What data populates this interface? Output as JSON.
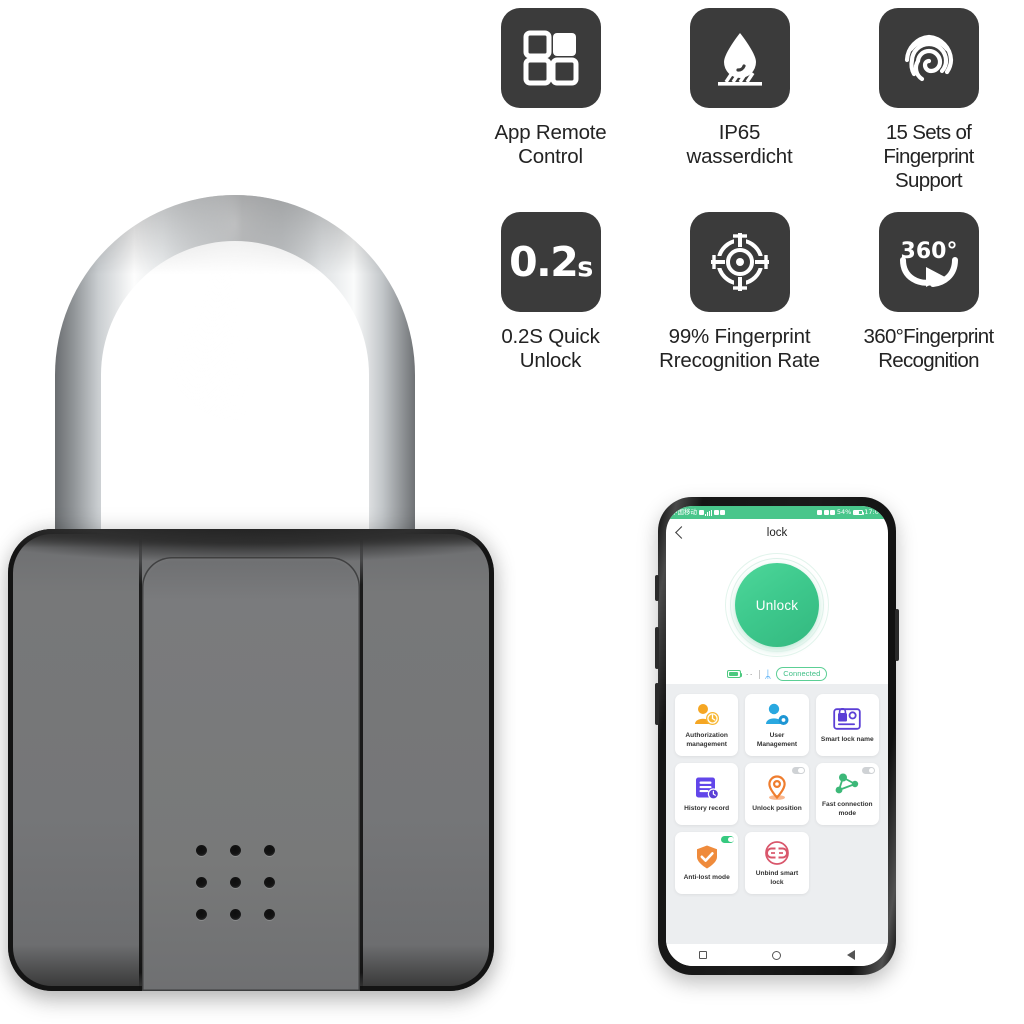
{
  "product": {
    "name": "Smart Fingerprint Padlock",
    "body_color": "#787878",
    "accent_dark": "#3b3b3b",
    "accent_green": "#3ec98d"
  },
  "features": [
    {
      "icon": "app-grid-icon",
      "label": "App Remote\nControl"
    },
    {
      "icon": "water-drop-icon",
      "label": "IP65\nwasserdicht"
    },
    {
      "icon": "fingerprint-icon",
      "label": "15 Sets of\nFingerprint\nSupport"
    },
    {
      "icon": "speed-text-icon",
      "label": "0.2S Quick\nUnlock",
      "tile_text": "0.2",
      "tile_unit": "s"
    },
    {
      "icon": "target-icon",
      "label": "99% Fingerprint\nRrecognition Rate"
    },
    {
      "icon": "rotate-360-icon",
      "label": "360°Fingerprint\nRecognition",
      "tile_text": "360°"
    }
  ],
  "phone": {
    "statusbar": {
      "carrier": "中国移动",
      "battery_percent": "54%",
      "time": "17:00"
    },
    "appbar": {
      "title": "lock",
      "back_icon": "back-chevron-icon"
    },
    "unlock_button": {
      "label": "Unlock"
    },
    "connection": {
      "battery_icon": "battery-icon",
      "signal_dots": "··",
      "bluetooth_icon": "bluetooth-icon",
      "bluetooth_glyph": "ᛦ",
      "status_label": "Connected"
    },
    "tiles": [
      {
        "icon": "authorization-icon",
        "label": "Authorization\nmanagement",
        "toggle": null
      },
      {
        "icon": "user-management-icon",
        "label": "User\nManagement",
        "toggle": null
      },
      {
        "icon": "smart-lock-name-icon",
        "label": "Smart lock name",
        "toggle": null
      },
      {
        "icon": "history-record-icon",
        "label": "History record",
        "toggle": null
      },
      {
        "icon": "unlock-position-icon",
        "label": "Unlock position",
        "toggle": "off"
      },
      {
        "icon": "fast-connection-icon",
        "label": "Fast connection\nmode",
        "toggle": "off"
      },
      {
        "icon": "anti-lost-icon",
        "label": "Anti-lost mode",
        "toggle": "on"
      },
      {
        "icon": "unbind-lock-icon",
        "label": "Unbind smart\nlock",
        "toggle": null
      }
    ],
    "navbar": [
      "recents-square-icon",
      "home-circle-icon",
      "back-triangle-icon"
    ]
  }
}
